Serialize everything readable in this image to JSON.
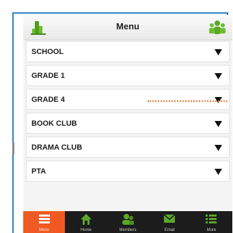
{
  "header": {
    "title": "Menu",
    "left_icon": "school-building-icon",
    "right_icon": "group-icon"
  },
  "menu": {
    "items": [
      {
        "label": "SCHOOL"
      },
      {
        "label": "GRADE 1"
      },
      {
        "label": "GRADE 4"
      },
      {
        "label": "BOOK CLUB"
      },
      {
        "label": "DRAMA CLUB"
      },
      {
        "label": "PTA"
      }
    ]
  },
  "tabbar": {
    "tabs": [
      {
        "label": "Menu",
        "icon": "list-icon",
        "active": true
      },
      {
        "label": "Home",
        "icon": "home-icon",
        "active": false
      },
      {
        "label": "Members",
        "icon": "members-icon",
        "active": false
      },
      {
        "label": "Email",
        "icon": "email-icon",
        "active": false
      },
      {
        "label": "More",
        "icon": "more-list-icon",
        "active": false
      }
    ]
  },
  "colors": {
    "frame": "#2c7fbf",
    "accent": "#f05a22",
    "icon_green": "#5aa826",
    "pointer_dots": "#e8732a"
  }
}
